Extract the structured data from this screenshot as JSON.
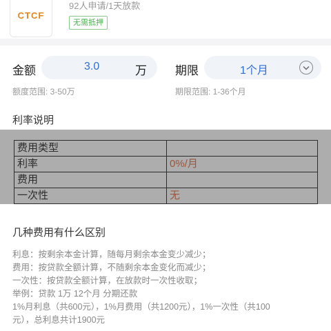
{
  "product": {
    "logo_text": "CTCF",
    "applicants": "92人申请/1天放款",
    "tag": "无需抵押"
  },
  "loan_form": {
    "amount_label": "金额",
    "amount_value": "3.0",
    "amount_unit": "万",
    "amount_range": "额度范围: 3-50万",
    "term_label": "期限",
    "term_value": "1个月",
    "term_range": "期限范围: 1-36个月"
  },
  "rate_section": {
    "title": "利率说明",
    "rows": [
      {
        "label": "费用类型",
        "value": ""
      },
      {
        "label": "利率",
        "value": "0%/月"
      },
      {
        "label": "费用",
        "value": ""
      },
      {
        "label": "一次性",
        "value": "无"
      }
    ]
  },
  "fee_section": {
    "title": "几种费用有什么区别",
    "lines": [
      "利息：按剩余本金计算，随每月剩余本金变少减少；",
      "费用：按贷款全额计算，不随剩余本金变化而减少；",
      "一次性：按贷款全额计算，在放款时一次性收取；",
      "举例：贷款 1万 12个月 分期还款",
      "1%月利息（共600元），1%月费用（共1200元），1%一次性（共100",
      "元），总利息共计1900元"
    ]
  }
}
